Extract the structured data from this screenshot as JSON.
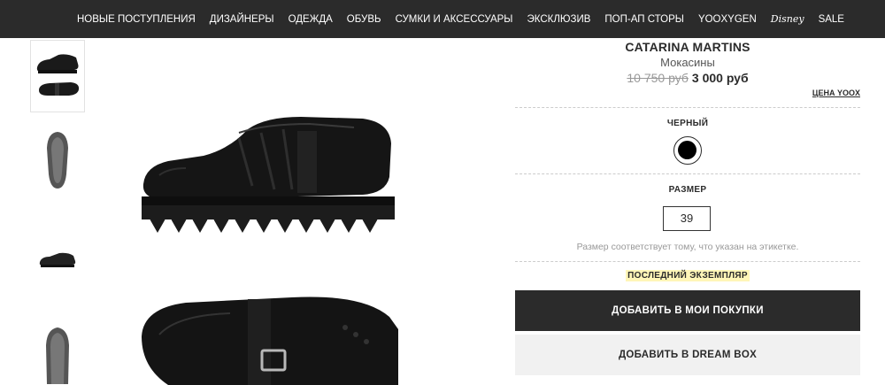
{
  "nav": {
    "items": [
      {
        "label": "НОВЫЕ ПОСТУПЛЕНИЯ"
      },
      {
        "label": "ДИЗАЙНЕРЫ"
      },
      {
        "label": "ОДЕЖДА"
      },
      {
        "label": "ОБУВЬ"
      },
      {
        "label": "СУМКИ И АКСЕССУАРЫ"
      },
      {
        "label": "ЭКСКЛЮЗИВ"
      },
      {
        "label": "ПОП-АП СТОРЫ"
      },
      {
        "label": "YOOXYGEN"
      },
      {
        "label": "Disney"
      },
      {
        "label": "SALE"
      }
    ]
  },
  "product": {
    "brand": "CATARINA MARTINS",
    "category": "Мокасины",
    "old_price": "10 750 руб",
    "new_price": "3 000 руб",
    "yoox_price_link": "ЦЕНА YOOX",
    "color_label": "ЧЕРНЫЙ",
    "color_hex": "#000000",
    "size_label": "РАЗМЕР",
    "size_value": "39",
    "size_note": "Размер соответствует тому, что указан на этикетке.",
    "stock_note": "ПОСЛЕДНИЙ ЭКЗЕМПЛЯР",
    "add_to_cart": "ДОБАВИТЬ В МОИ ПОКУПКИ",
    "add_to_dreambox": "ДОБАВИТЬ В DREAM BOX"
  },
  "thumbnails": [
    {
      "view": "side-and-top",
      "active": true
    },
    {
      "view": "sole",
      "active": false
    },
    {
      "view": "side-small",
      "active": false
    },
    {
      "view": "sole-partial",
      "active": false
    }
  ]
}
